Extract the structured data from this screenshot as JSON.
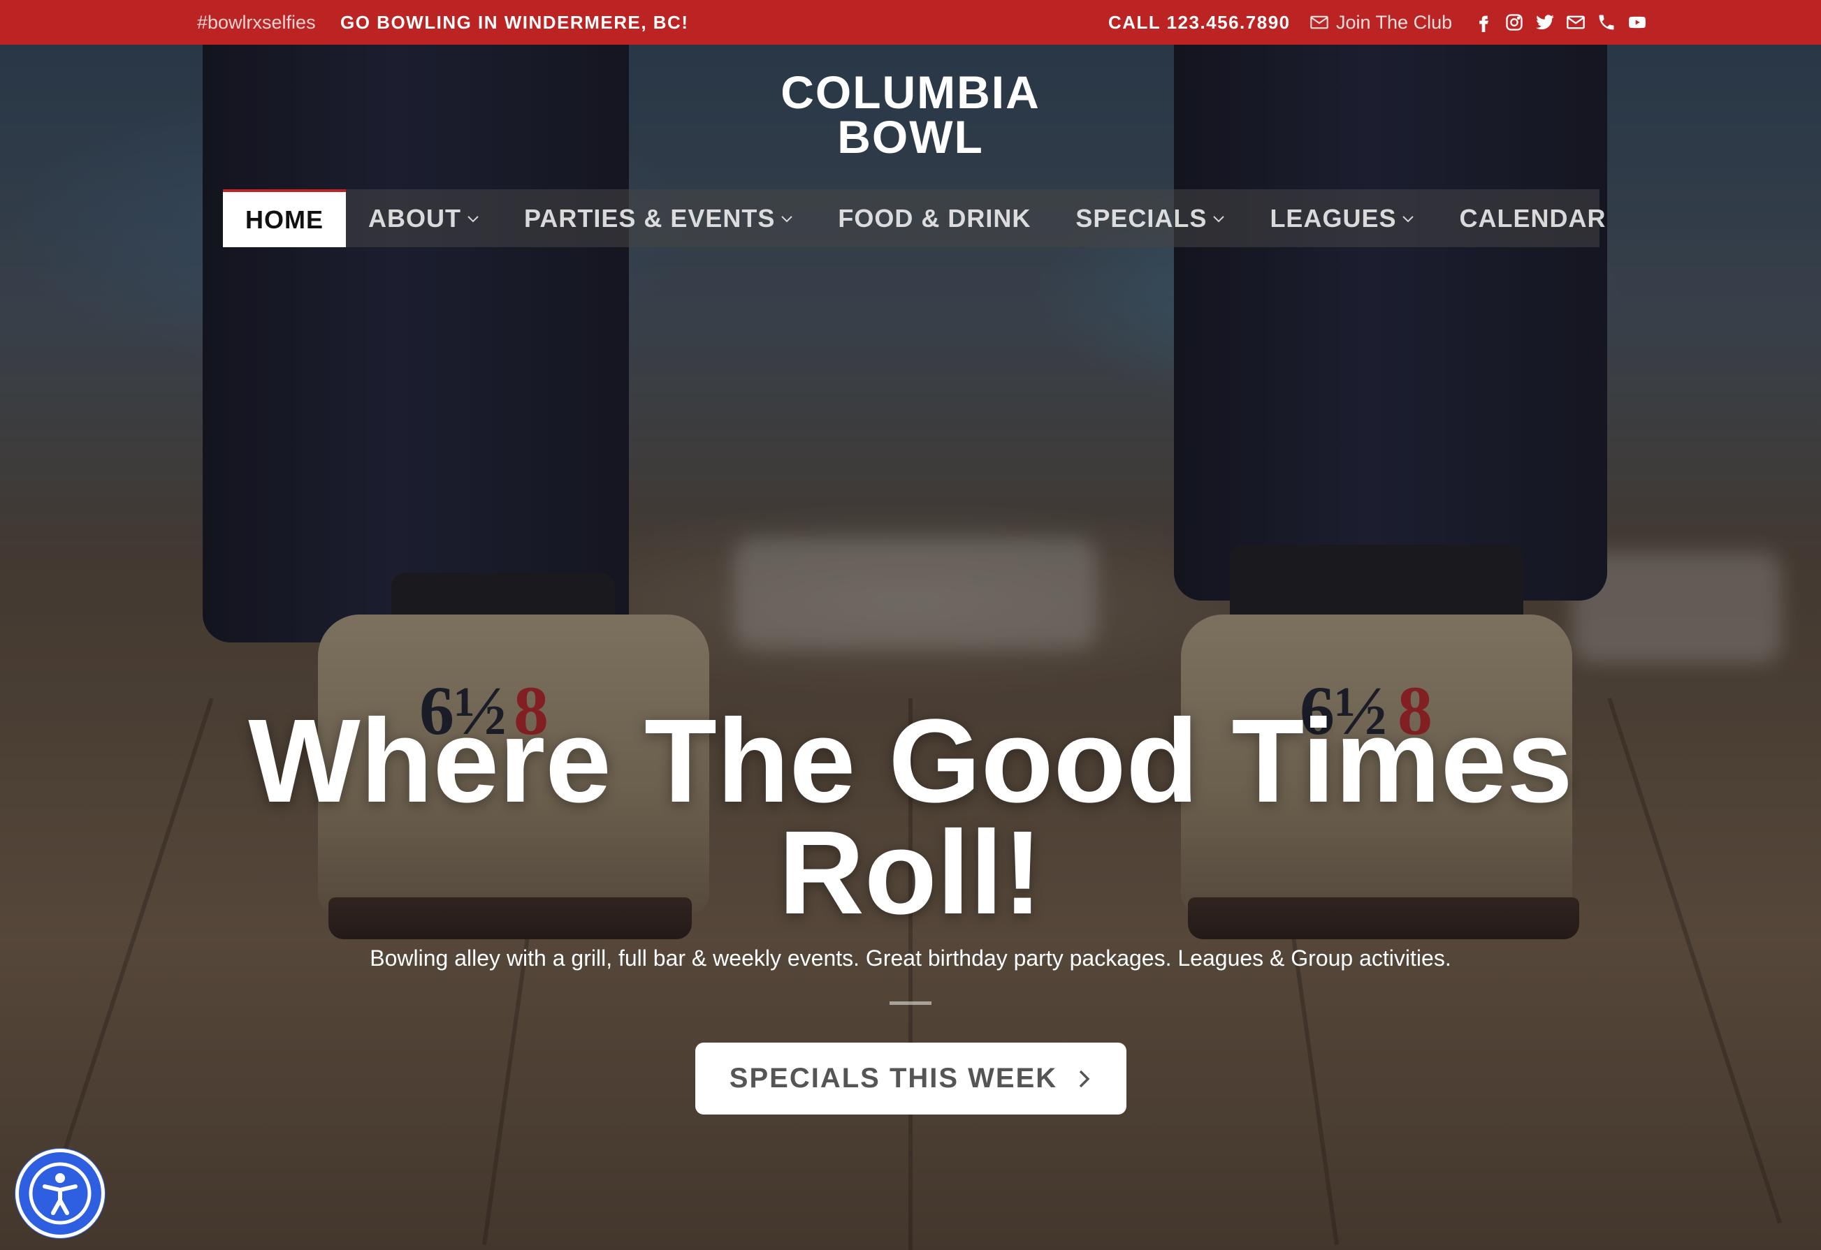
{
  "topbar": {
    "hashtag": "#bowlrxselfies",
    "promo": "GO BOWLING IN WINDERMERE, BC!",
    "phone": "CALL 123.456.7890",
    "join_label": "Join The Club",
    "bg_color": "#bc2424",
    "social_icons": [
      "facebook-icon",
      "instagram-icon",
      "twitter-icon",
      "email-icon",
      "phone-icon",
      "youtube-icon"
    ]
  },
  "logo": {
    "line1": "COLUMBIA",
    "line2": "BOWL"
  },
  "nav": {
    "items": [
      {
        "label": "HOME",
        "active": true,
        "dropdown": false
      },
      {
        "label": "ABOUT",
        "active": false,
        "dropdown": true
      },
      {
        "label": "PARTIES & EVENTS",
        "active": false,
        "dropdown": true
      },
      {
        "label": "FOOD & DRINK",
        "active": false,
        "dropdown": false
      },
      {
        "label": "SPECIALS",
        "active": false,
        "dropdown": true
      },
      {
        "label": "LEAGUES",
        "active": false,
        "dropdown": true
      },
      {
        "label": "CALENDAR",
        "active": false,
        "dropdown": false
      }
    ]
  },
  "hero": {
    "headline_line1": "Where The Good Times",
    "headline_line2": "Roll!",
    "subtitle": "Bowling alley with a grill, full bar & weekly events. Great birthday party packages. Leagues & Group activities.",
    "cta_label": "SPECIALS THIS WEEK",
    "shoe_size": "6½",
    "shoe_number": "8"
  },
  "accessibility": {
    "icon": "accessibility-icon",
    "color": "#2e5fe0"
  }
}
